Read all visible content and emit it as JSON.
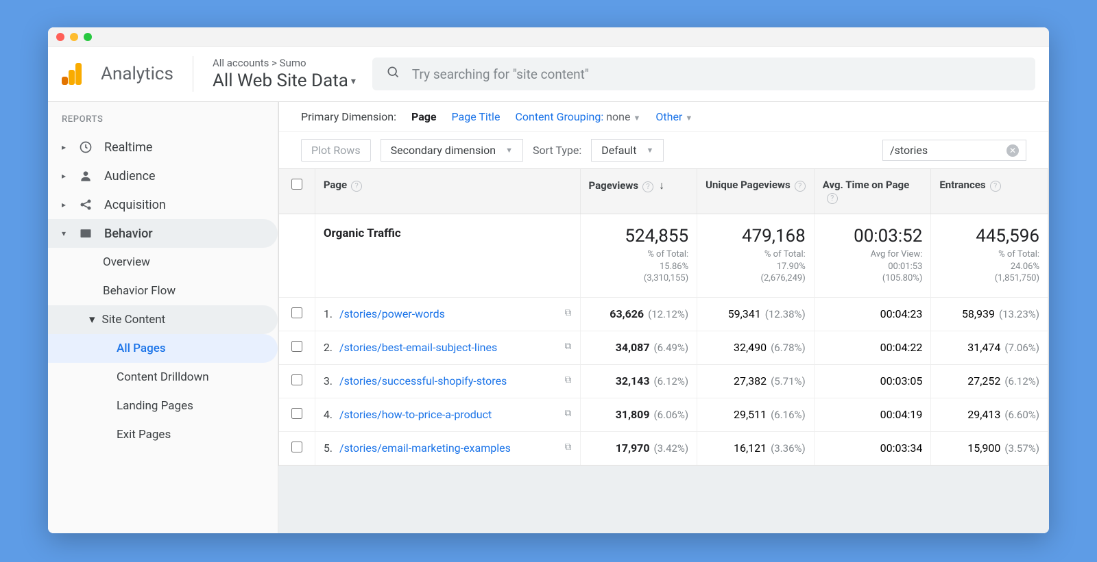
{
  "product_name": "Analytics",
  "breadcrumbs": "All accounts > Sumo",
  "view_name": "All Web Site Data",
  "search": {
    "placeholder": "Try searching for \"site content\""
  },
  "sidebar": {
    "section_label": "REPORTS",
    "items": [
      {
        "label": "Realtime"
      },
      {
        "label": "Audience"
      },
      {
        "label": "Acquisition"
      },
      {
        "label": "Behavior"
      }
    ],
    "behavior": [
      {
        "label": "Overview"
      },
      {
        "label": "Behavior Flow"
      },
      {
        "label": "Site Content"
      },
      {
        "label": "All Pages"
      },
      {
        "label": "Content Drilldown"
      },
      {
        "label": "Landing Pages"
      },
      {
        "label": "Exit Pages"
      }
    ]
  },
  "dimension": {
    "label": "Primary Dimension:",
    "selected": "Page",
    "page_title": "Page Title",
    "content_grouping_label": "Content Grouping:",
    "content_grouping_value": "none",
    "other": "Other"
  },
  "toolbar": {
    "plot_rows": "Plot Rows",
    "secondary_dim": "Secondary dimension",
    "sort_type_label": "Sort Type:",
    "sort_type_value": "Default",
    "filter_value": "/stories"
  },
  "columns": {
    "page": "Page",
    "pageviews": "Pageviews",
    "unique": "Unique Pageviews",
    "avg_time": "Avg. Time on Page",
    "entrances": "Entrances"
  },
  "summary": {
    "segment": "Organic Traffic",
    "pageviews": {
      "value": "524,855",
      "sub1": "% of Total:",
      "sub2": "15.86%",
      "sub3": "(3,310,155)"
    },
    "unique": {
      "value": "479,168",
      "sub1": "% of Total:",
      "sub2": "17.90%",
      "sub3": "(2,676,249)"
    },
    "avg_time": {
      "value": "00:03:52",
      "sub1": "Avg for View:",
      "sub2": "00:01:53",
      "sub3": "(105.80%)"
    },
    "entrances": {
      "value": "445,596",
      "sub1": "% of Total:",
      "sub2": "24.06%",
      "sub3": "(1,851,750)"
    }
  },
  "rows": [
    {
      "n": "1.",
      "page": "/stories/power-words",
      "pv": "63,626",
      "pv_pct": "(12.12%)",
      "up": "59,341",
      "up_pct": "(12.38%)",
      "time": "00:04:23",
      "ent": "58,939",
      "ent_pct": "(13.23%)"
    },
    {
      "n": "2.",
      "page": "/stories/best-email-subject-lines",
      "pv": "34,087",
      "pv_pct": "(6.49%)",
      "up": "32,490",
      "up_pct": "(6.78%)",
      "time": "00:04:22",
      "ent": "31,474",
      "ent_pct": "(7.06%)"
    },
    {
      "n": "3.",
      "page": "/stories/successful-shopify-stores",
      "pv": "32,143",
      "pv_pct": "(6.12%)",
      "up": "27,382",
      "up_pct": "(5.71%)",
      "time": "00:03:05",
      "ent": "27,252",
      "ent_pct": "(6.12%)"
    },
    {
      "n": "4.",
      "page": "/stories/how-to-price-a-product",
      "pv": "31,809",
      "pv_pct": "(6.06%)",
      "up": "29,511",
      "up_pct": "(6.16%)",
      "time": "00:04:19",
      "ent": "29,413",
      "ent_pct": "(6.60%)"
    },
    {
      "n": "5.",
      "page": "/stories/email-marketing-examples",
      "pv": "17,970",
      "pv_pct": "(3.42%)",
      "up": "16,121",
      "up_pct": "(3.36%)",
      "time": "00:03:34",
      "ent": "15,900",
      "ent_pct": "(3.57%)"
    }
  ]
}
